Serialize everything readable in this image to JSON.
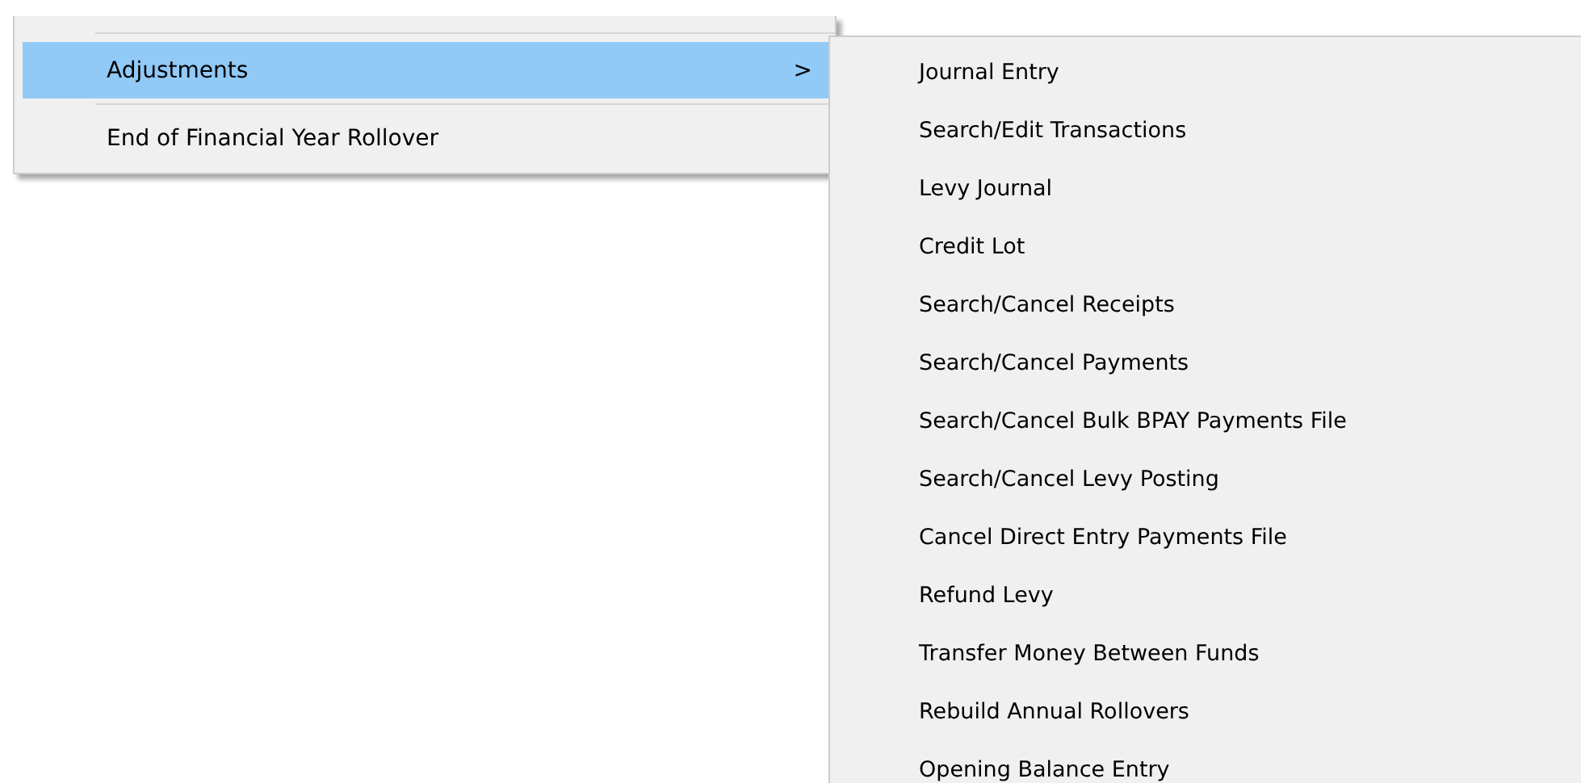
{
  "menu": {
    "items": [
      {
        "label": "Adjustments",
        "kind": "submenu",
        "selected": true,
        "arrow": ">"
      },
      {
        "label": "End of Financial Year Rollover",
        "kind": "command",
        "selected": false
      }
    ]
  },
  "submenu": {
    "items": [
      {
        "label": "Journal Entry"
      },
      {
        "label": "Search/Edit Transactions"
      },
      {
        "label": "Levy Journal"
      },
      {
        "label": "Credit Lot"
      },
      {
        "label": "Search/Cancel Receipts"
      },
      {
        "label": "Search/Cancel Payments"
      },
      {
        "label": "Search/Cancel Bulk BPAY Payments File"
      },
      {
        "label": "Search/Cancel Levy Posting"
      },
      {
        "label": "Cancel Direct Entry Payments File"
      },
      {
        "label": "Refund Levy"
      },
      {
        "label": "Transfer Money Between Funds"
      },
      {
        "label": "Rebuild Annual Rollovers"
      },
      {
        "label": "Opening Balance Entry"
      }
    ]
  }
}
